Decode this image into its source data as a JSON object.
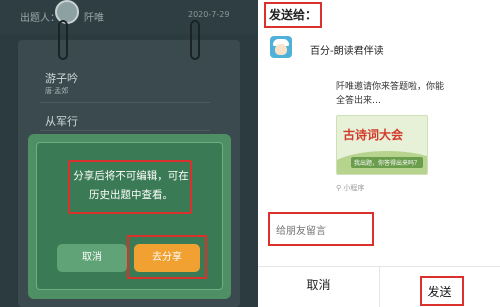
{
  "left": {
    "header": {
      "label": "出题人：",
      "name": "阡唯",
      "date": "2020-7-29"
    },
    "poems": [
      {
        "title": "游子吟",
        "author": "唐·孟郊"
      },
      {
        "title": "从军行"
      }
    ],
    "modal": {
      "message": "分享后将不可编辑，可在历史出题中查看。",
      "cancel_label": "取消",
      "share_label": "去分享"
    }
  },
  "right": {
    "title": "发送给：",
    "recipient": {
      "name": "百分-朗读君伴读",
      "icon": "avatar-icon"
    },
    "invite": {
      "text": "阡唯邀请你来答题啦，你能全答出来…",
      "banner_title": "古诗词大会",
      "banner_sub": "我出题，你答得出来吗？",
      "mini_label": "小程序"
    },
    "message_placeholder": "给朋友留言",
    "cancel_label": "取消",
    "send_label": "发送"
  },
  "colors": {
    "accent_red": "#d9322c",
    "modal_green": "#4e8f63",
    "share_orange": "#f1a032",
    "dark_bg": "#2c3b3f"
  }
}
